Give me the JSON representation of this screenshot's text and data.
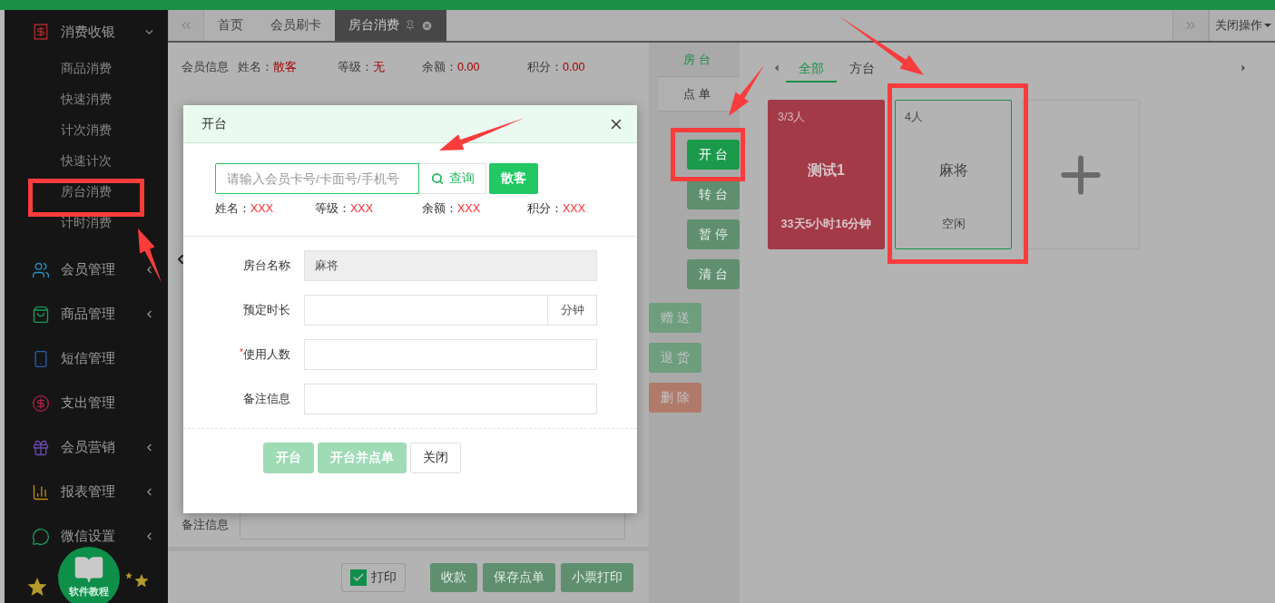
{
  "sidebar": {
    "items": [
      {
        "label": "消费收银",
        "expanded": true,
        "children": [
          {
            "label": "商品消费"
          },
          {
            "label": "快速消费"
          },
          {
            "label": "计次消费"
          },
          {
            "label": "快速计次"
          },
          {
            "label": "房台消费"
          },
          {
            "label": "计时消费"
          }
        ]
      },
      {
        "label": "会员管理",
        "expanded": false
      },
      {
        "label": "商品管理",
        "expanded": false
      },
      {
        "label": "短信管理"
      },
      {
        "label": "支出管理"
      },
      {
        "label": "会员营销",
        "expanded": false
      },
      {
        "label": "报表管理",
        "expanded": false
      },
      {
        "label": "微信设置",
        "expanded": false
      }
    ],
    "tutorial_badge": {
      "label": "软件教程"
    }
  },
  "tab_bar": {
    "tabs": [
      {
        "label": "首页",
        "selected": false
      },
      {
        "label": "会员刷卡",
        "selected": false
      },
      {
        "label": "房台消费",
        "selected": true
      }
    ],
    "close_menu": "关闭操作"
  },
  "member_info": {
    "title": "会员信息",
    "fields": [
      {
        "label": "姓名：",
        "value": "散客"
      },
      {
        "label": "等级：",
        "value": "无"
      },
      {
        "label": "余额：",
        "value": "0.00"
      },
      {
        "label": "积分：",
        "value": "0.00"
      }
    ]
  },
  "remark": {
    "label": "备注信息"
  },
  "footer": {
    "print": {
      "label": "打印",
      "checked": true
    },
    "buttons": [
      "收款",
      "保存点单",
      "小票打印"
    ]
  },
  "side_panel": {
    "tabs": [
      {
        "label": "房台",
        "selected": true
      },
      {
        "label": "点单",
        "selected": false
      }
    ],
    "table_actions": [
      {
        "label": "开台",
        "disabled": false
      },
      {
        "label": "转台",
        "disabled": true
      },
      {
        "label": "暂停",
        "disabled": true
      },
      {
        "label": "清台",
        "disabled": true
      }
    ],
    "order_actions": [
      {
        "label": "赠送",
        "kind": "normal"
      },
      {
        "label": "退货",
        "kind": "normal"
      },
      {
        "label": "删除",
        "kind": "danger"
      }
    ]
  },
  "room_area": {
    "categories": [
      {
        "label": "全部",
        "selected": true
      },
      {
        "label": "方台",
        "selected": false
      }
    ],
    "rooms": [
      {
        "capacity": "3/3人",
        "name": "测试1",
        "status": "33天5小时16分钟",
        "occupied": true
      },
      {
        "capacity": "4人",
        "name": "麻将",
        "status": "空闲",
        "occupied": false
      }
    ]
  },
  "dialog": {
    "title": "开台",
    "search": {
      "placeholder": "请输入会员卡号/卡面号/手机号",
      "button": "查询"
    },
    "walk_in_button": "散客",
    "member_fields": [
      {
        "label": "姓名：",
        "value": "XXX"
      },
      {
        "label": "等级：",
        "value": "XXX"
      },
      {
        "label": "余额：",
        "value": "XXX"
      },
      {
        "label": "积分：",
        "value": "XXX"
      }
    ],
    "form": [
      {
        "label": "房台名称",
        "kind": "readonly",
        "value": "麻将"
      },
      {
        "label": "预定时长",
        "kind": "addon",
        "addon": "分钟"
      },
      {
        "label": "使用人数",
        "kind": "text",
        "required_mark": "*"
      },
      {
        "label": "备注信息",
        "kind": "text"
      }
    ],
    "buttons": [
      {
        "label": "开台",
        "kind": "primary"
      },
      {
        "label": "开台并点单",
        "kind": "primary"
      },
      {
        "label": "关闭",
        "kind": "default"
      }
    ]
  }
}
